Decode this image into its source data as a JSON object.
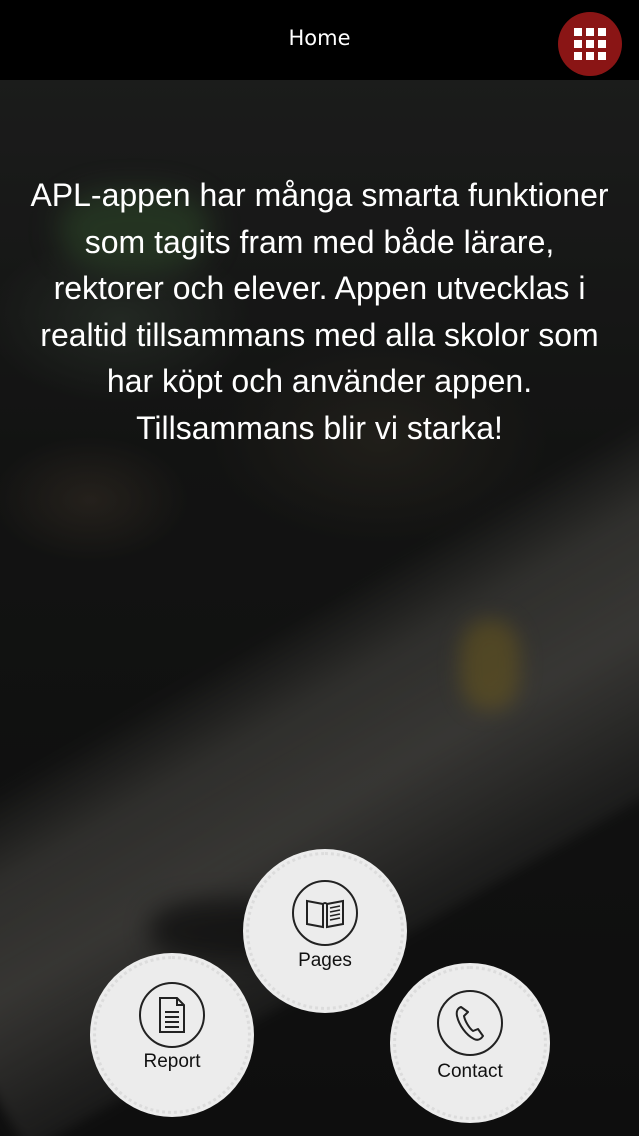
{
  "header": {
    "title": "Home",
    "menu_icon": "grid-icon",
    "menu_color": "#8a1515"
  },
  "intro": {
    "text": "APL-appen har många smarta funktioner som tagits fram med både lärare, rektorer och elever. Appen utvecklas i realtid tillsammans med alla skolor som har köpt och använder appen. Tillsammans blir vi starka!"
  },
  "actions": {
    "pages": {
      "label": "Pages",
      "icon": "book-icon"
    },
    "report": {
      "label": "Report",
      "icon": "document-icon"
    },
    "contact": {
      "label": "Contact",
      "icon": "phone-icon"
    }
  }
}
